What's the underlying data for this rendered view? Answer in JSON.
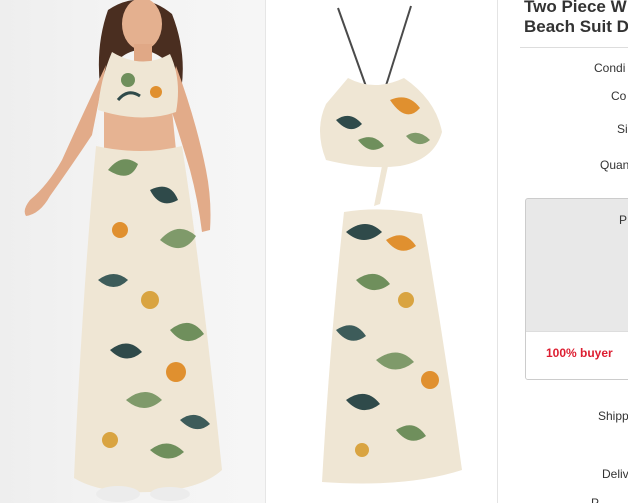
{
  "listing": {
    "title_line1": "Two Piece W",
    "title_line2": "Beach Suit D"
  },
  "specs": {
    "condition": "Condi",
    "color": "Co",
    "size": "Si",
    "quantity": "Quan"
  },
  "purchase_box": {
    "price_label": "P",
    "guarantee": "100% buyer"
  },
  "shipping": {
    "shipping_label": "Shipp",
    "delivery_label": "Deliv",
    "payments_label": "P"
  },
  "colors": {
    "fabric": "#efe6d4",
    "guarantee_red": "#dd1e31",
    "leaf_green": "#6f8f5c",
    "leaf_dark": "#2f4a4a",
    "flower_orange": "#e0902f"
  }
}
